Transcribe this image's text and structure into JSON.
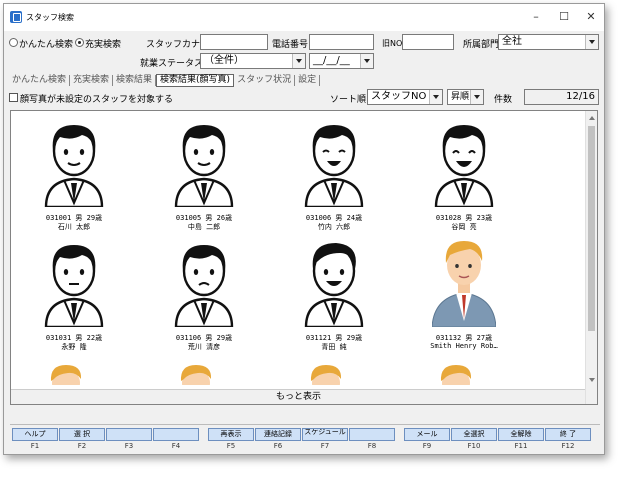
{
  "window": {
    "title": "スタッフ検索",
    "controls": {
      "minimize": "–",
      "maximize": "☐",
      "close": "✕"
    }
  },
  "search": {
    "mode_simple": "かんたん検索",
    "mode_full": "充実検索",
    "kana_label": "スタッフカナ",
    "kana_value": "",
    "phone_label": "電話番号",
    "phone_value": "",
    "oldno_label": "旧NO",
    "oldno_value": "",
    "dept_label": "所属部門",
    "dept_value": "全社",
    "status_label": "就業ステータス",
    "status_value": "（全件）",
    "date_value": "__/__/__"
  },
  "tabs": [
    "かんたん検索",
    "充実検索",
    "検索結果",
    "検索結果(顔写真)",
    "スタッフ状況",
    "設定"
  ],
  "toolbar": {
    "checkbox_label": "顔写真が未設定のスタッフを対象する",
    "sort_label": "ソート順",
    "sort_value": "スタッフNO",
    "order_value": "昇順",
    "count_label": "件数",
    "count_value": "12/16"
  },
  "staff": [
    {
      "line1": "031001  男  29歳",
      "line2": "石川  太郎",
      "avatar": "cartoon-man-icon"
    },
    {
      "line1": "031005  男  26歳",
      "line2": "中島  二郎",
      "avatar": "cartoon-man-icon"
    },
    {
      "line1": "031006  男  24歳",
      "line2": "竹内  六郎",
      "avatar": "cartoon-man-icon"
    },
    {
      "line1": "031028  男  23歳",
      "line2": "谷岡  亮",
      "avatar": "cartoon-man-icon"
    },
    {
      "line1": "031031  男  22歳",
      "line2": "永野  隆",
      "avatar": "cartoon-man-icon"
    },
    {
      "line1": "031106  男  29歳",
      "line2": "荒川  清彦",
      "avatar": "cartoon-man-icon"
    },
    {
      "line1": "031121  男  29歳",
      "line2": "青田  純",
      "avatar": "cartoon-man-icon"
    },
    {
      "line1": "031132  男  27歳",
      "line2": "Smith Henry Rob…",
      "avatar": "businessman-illustration-icon"
    }
  ],
  "more_label": "もっと表示",
  "fkeys": [
    {
      "label": "ヘルプ",
      "key": "F1"
    },
    {
      "label": "選  択",
      "key": "F2"
    },
    {
      "label": "",
      "key": "F3"
    },
    {
      "label": "",
      "key": "F4"
    },
    {
      "label": "再表示",
      "key": "F5"
    },
    {
      "label": "連絡記録",
      "key": "F6"
    },
    {
      "label": "スケジュール",
      "key": "F7"
    },
    {
      "label": "",
      "key": "F8"
    },
    {
      "label": "メール",
      "key": "F9"
    },
    {
      "label": "全選択",
      "key": "F10"
    },
    {
      "label": "全解除",
      "key": "F11"
    },
    {
      "label": "終  了",
      "key": "F12"
    }
  ],
  "colors": {
    "fkey_bg": "#cfe1f7",
    "fkey_border": "#6d8fbf",
    "suit": "#7d98b3",
    "tie": "#c0392b",
    "hair_blond": "#e8a83a"
  }
}
